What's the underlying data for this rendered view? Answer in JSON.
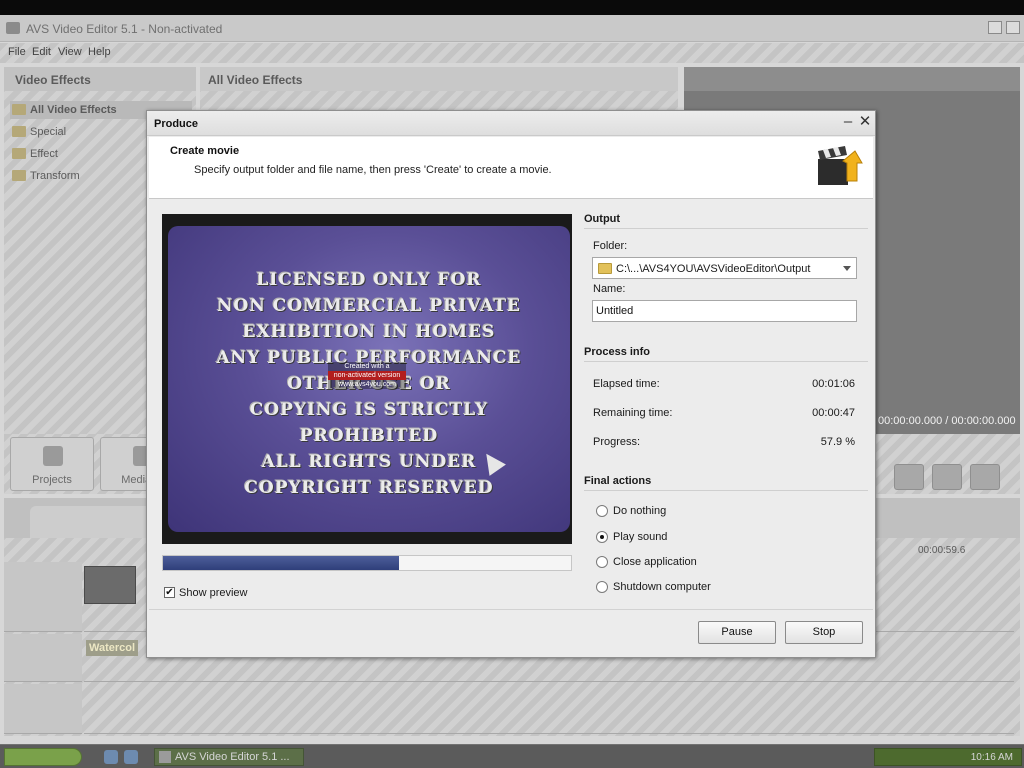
{
  "app": {
    "title": "AVS Video Editor 5.1 - Non-activated",
    "menu": [
      "File",
      "Edit",
      "View",
      "Help"
    ],
    "left_panel": {
      "header": "Video Effects",
      "items": [
        "All Video Effects",
        "Special",
        "Effect",
        "Transform"
      ]
    },
    "mid_panel": {
      "header": "All Video Effects"
    },
    "time_readout": "00:00:00.000 / 00:00:00.000",
    "big_buttons": [
      "Projects",
      "Media Li"
    ],
    "timeline_time": "00:00:59.6",
    "track_label": "Watercol"
  },
  "taskbar": {
    "task_label": "AVS Video Editor 5.1 ...",
    "clock": "10:16 AM"
  },
  "dialog": {
    "title": "Produce",
    "heading": "Create movie",
    "subheading": "Specify output folder and file name, then press 'Create' to create a movie.",
    "preview_lines": [
      "LICENSED ONLY FOR",
      "NON COMMERCIAL PRIVATE",
      "EXHIBITION IN HOMES",
      "ANY PUBLIC PERFORMANCE",
      "OTHER USE OR",
      "COPYING IS STRICTLY",
      "PROHIBITED",
      "ALL RIGHTS UNDER",
      "COPYRIGHT RESERVED"
    ],
    "watermark": [
      "Created with a",
      "non-activated version",
      "www.avs4you.com"
    ],
    "progress_fraction": 0.579,
    "show_preview": {
      "label": "Show preview",
      "checked": true
    },
    "output": {
      "section": "Output",
      "folder_label": "Folder:",
      "folder_value": "C:\\...\\AVS4YOU\\AVSVideoEditor\\Output",
      "name_label": "Name:",
      "name_value": "Untitled"
    },
    "process_info": {
      "section": "Process info",
      "rows": [
        {
          "label": "Elapsed time:",
          "value": "00:01:06"
        },
        {
          "label": "Remaining time:",
          "value": "00:00:47"
        },
        {
          "label": "Progress:",
          "value": "57.9 %"
        }
      ]
    },
    "final_actions": {
      "section": "Final actions",
      "options": [
        "Do nothing",
        "Play sound",
        "Close application",
        "Shutdown computer"
      ],
      "selected": "Play sound"
    },
    "buttons": {
      "pause": "Pause",
      "stop": "Stop"
    }
  }
}
